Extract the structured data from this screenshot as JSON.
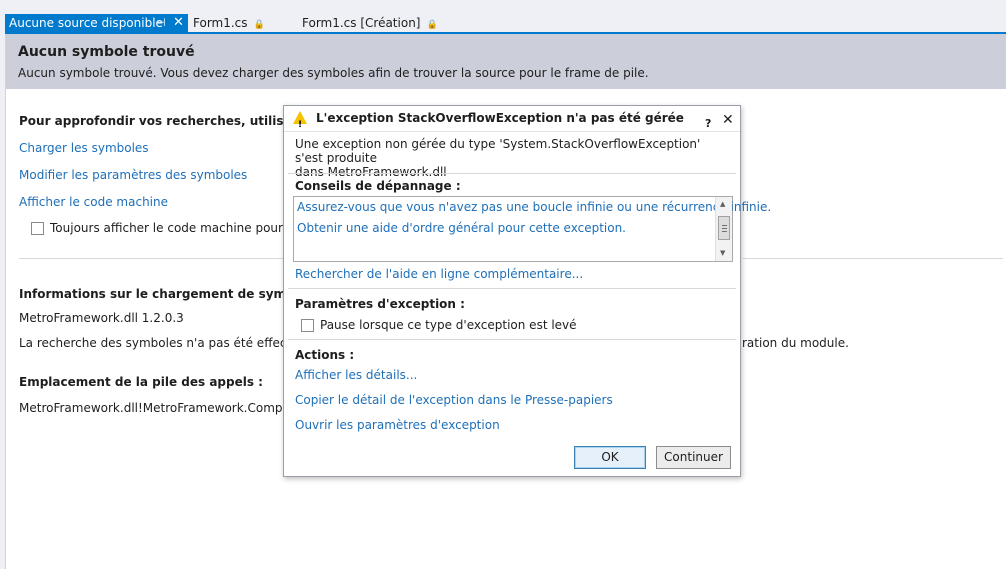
{
  "tabs": [
    {
      "label": "Aucune source disponible",
      "active": true,
      "pin_glyph": "⊣",
      "close_glyph": "✕"
    },
    {
      "label": "Form1.cs",
      "lock_glyph": "🔒"
    },
    {
      "label": "Form1.cs [Création]",
      "lock_glyph": "🔒"
    }
  ],
  "banner": {
    "title": "Aucun symbole trouvé",
    "message": "Aucun symbole trouvé. Vous devez charger des symboles afin de trouver la source pour le frame de pile."
  },
  "content": {
    "investigate_heading": "Pour approfondir vos recherches, utilisez l'une c",
    "links": [
      "Charger les symboles",
      "Modifier les paramètres des symboles",
      "Afficher le code machine"
    ],
    "always_show_label": "Toujours afficher le code machine pour les fi",
    "symbol_load_heading": "Informations sur le chargement de symboles :",
    "module_version": "MetroFramework.dll 1.2.0.3",
    "search_msg_left": "La recherche des symboles n'a pas été effectuée po",
    "search_msg_right": "ration du module.",
    "callstack_heading": "Emplacement de la pile des appels :",
    "callstack_value": "MetroFramework.dll!MetroFramework.Component"
  },
  "dialog": {
    "title": "L'exception StackOverflowException n'a pas été gérée",
    "help_glyph": "?",
    "close_glyph": "✕",
    "warning_glyph": "!",
    "message_line1": "Une exception non gérée du type 'System.StackOverflowException' s'est produite",
    "message_line2": "dans MetroFramework.dll",
    "tips_heading": "Conseils de dépannage :",
    "tips": [
      "Assurez-vous que vous n'avez pas une boucle infinie ou une récurrence infinie.",
      "Obtenir une aide d'ordre général pour cette exception."
    ],
    "scroll_up_glyph": "▲",
    "scroll_down_glyph": "▼",
    "online_help_link": "Rechercher de l'aide en ligne complémentaire...",
    "exception_settings_heading": "Paramètres d'exception :",
    "pause_label": "Pause lorsque ce type d'exception est levé",
    "pause_checked": false,
    "actions_heading": "Actions :",
    "actions": [
      "Afficher les détails...",
      "Copier le détail de l'exception dans le Presse-papiers",
      "Ouvrir les paramètres d'exception"
    ],
    "ok_label": "OK",
    "continue_label": "Continuer"
  },
  "colors": {
    "accent": "#007acc",
    "link": "#1e6fb8",
    "banner_bg": "#ccced9",
    "warning": "#f5c400"
  }
}
